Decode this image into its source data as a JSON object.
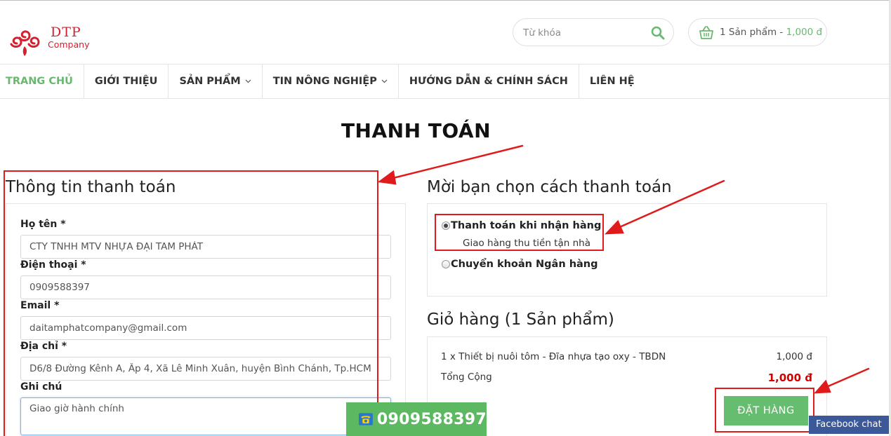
{
  "header": {
    "logo_name": "DTP",
    "logo_sub": "Company",
    "search": {
      "placeholder": "Từ khóa",
      "value": ""
    },
    "cart": {
      "count_text": "1 Sản phẩm - ",
      "price": "1,000 đ"
    }
  },
  "nav": {
    "items": [
      {
        "label": "TRANG CHỦ",
        "active": true
      },
      {
        "label": "GIỚI THIỆU"
      },
      {
        "label": "SẢN PHẨM",
        "has_dropdown": true
      },
      {
        "label": "TIN NÔNG NGHIỆP",
        "has_dropdown": true
      },
      {
        "label": "HƯỚNG DẪN & CHÍNH SÁCH"
      },
      {
        "label": "LIÊN HỆ"
      }
    ]
  },
  "page": {
    "title": "THANH TOÁN"
  },
  "billing": {
    "title": "Thông tin thanh toán",
    "fields": {
      "name": {
        "label": "Họ tên *",
        "value": "CTY TNHH MTV NHỰA ĐẠI TAM PHÁT"
      },
      "phone": {
        "label": "Điện thoại *",
        "value": "0909588397"
      },
      "email": {
        "label": "Email *",
        "value": "daitamphatcompany@gmail.com"
      },
      "address": {
        "label": "Địa chỉ *",
        "value": "D6/8 Đường Kênh A, Ấp 4, Xã Lê Minh Xuân, huyện Bình Chánh, Tp.HCM"
      },
      "note": {
        "label": "Ghi chú",
        "value": "Giao giờ hành chính"
      }
    }
  },
  "payment": {
    "title": "Mời bạn chọn cách thanh toán",
    "options": [
      {
        "label": "Thanh toán khi nhận hàng",
        "desc": "Giao hàng thu tiền tận nhà",
        "selected": true
      },
      {
        "label": "Chuyển khoản Ngân hàng",
        "selected": false
      }
    ]
  },
  "cart": {
    "title": "Giỏ hàng (1 Sản phẩm)",
    "items": [
      {
        "name": "1 x Thiết bị nuôi tôm - Đĩa nhựa tạo oxy - TBDN",
        "price": "1,000 đ"
      }
    ],
    "total_label": "Tổng Cộng",
    "total_value": "1,000 đ",
    "order_button": "ĐẶT HÀNG"
  },
  "floating": {
    "phone": "0909588397",
    "facebook_chat": "Facebook chat"
  },
  "colors": {
    "accent_green": "#67b96e",
    "brand_red": "#d4202f",
    "total_red": "#d40000",
    "annotation_red": "#e01b1b",
    "facebook_blue": "#3b5998"
  }
}
